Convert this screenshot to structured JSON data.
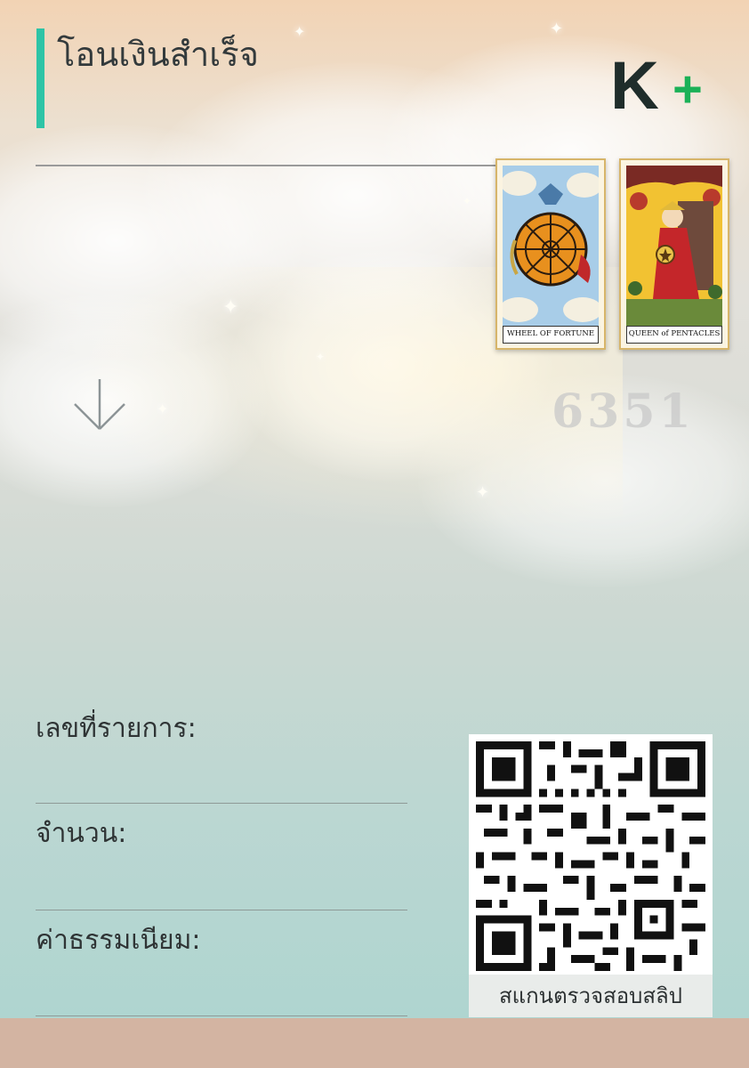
{
  "header": {
    "title": "โอนเงินสำเร็จ",
    "logo_text": "K+",
    "logo_letter": "K",
    "logo_plus": "+"
  },
  "colors": {
    "accent": "#2ec4a6",
    "logo_dark": "#1f2d2b",
    "logo_green": "#1bb157",
    "bottom_bar": "#d3b4a2"
  },
  "decoration": {
    "code_number": "6351",
    "cards": [
      {
        "caption": "WHEEL OF FORTUNE"
      },
      {
        "caption": "QUEEN of PENTACLES"
      }
    ],
    "arrow_icon": "arrow-down-icon"
  },
  "fields": {
    "reference_label": "เลขที่รายการ:",
    "amount_label": "จำนวน:",
    "fee_label": "ค่าธรรมเนียม:"
  },
  "qr": {
    "caption": "สแกนตรวจสอบสลิป"
  }
}
